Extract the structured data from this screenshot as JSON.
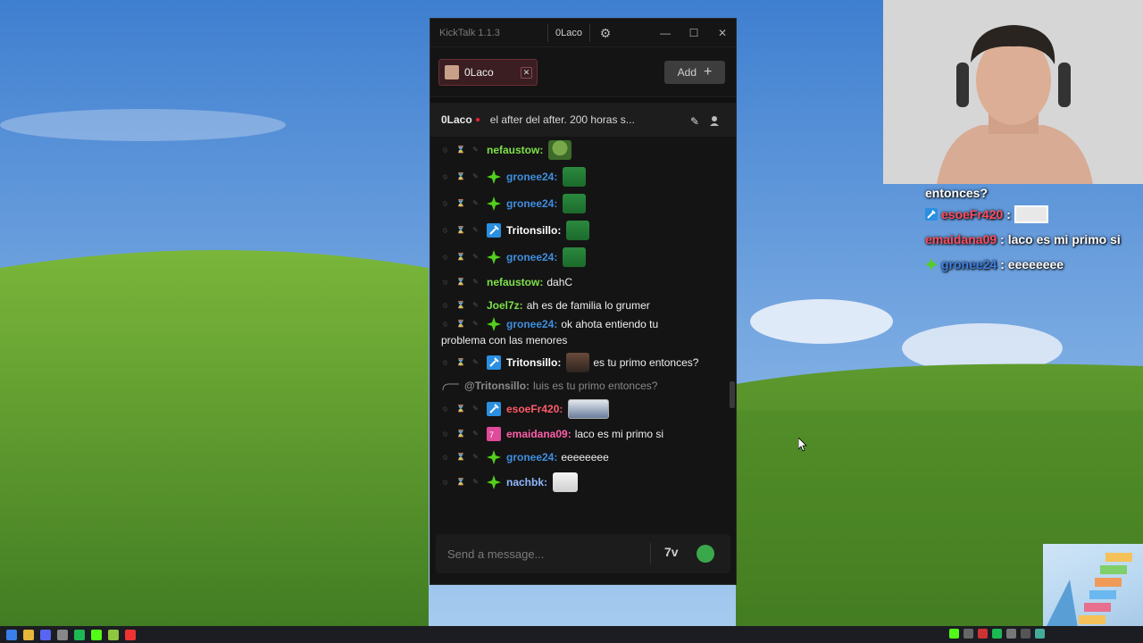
{
  "window": {
    "app_title": "KickTalk 1.1.3",
    "user_chip": "0Laco",
    "minimize_glyph": "—",
    "maximize_glyph": "☐",
    "close_glyph": "✕",
    "gear_glyph": "⚙"
  },
  "tabs": {
    "active_tab_label": "0Laco",
    "tab_close_glyph": "✕",
    "add_label": "Add",
    "add_glyph": "+"
  },
  "channel": {
    "name": "0Laco",
    "title": "el after del after. 200 horas s...",
    "pin_glyph": "✎",
    "user_glyph": "👤"
  },
  "chat": {
    "messages": [
      {
        "user": "nefaustow:",
        "color": "#7ee04a",
        "badge": "none",
        "text": "",
        "emote": "pepe"
      },
      {
        "user": "gronee24:",
        "color": "#3f8fe0",
        "badge": "green-star",
        "text": "",
        "emote": "green"
      },
      {
        "user": "gronee24:",
        "color": "#3f8fe0",
        "badge": "green-star",
        "text": "",
        "emote": "green"
      },
      {
        "user": "Tritonsillo:",
        "color": "#ffffff",
        "badge": "blue-hammer",
        "text": "",
        "emote": "green"
      },
      {
        "user": "gronee24:",
        "color": "#3f8fe0",
        "badge": "green-star",
        "text": "",
        "emote": "green"
      },
      {
        "user": "nefaustow:",
        "color": "#7ee04a",
        "badge": "none",
        "text": "dahC",
        "emote": ""
      },
      {
        "user": "Joel7z:",
        "color": "#7ee04a",
        "badge": "none",
        "text": "ah es de familia lo grumer",
        "emote": ""
      },
      {
        "user": "gronee24:",
        "color": "#3f8fe0",
        "badge": "green-star",
        "text": "ok ahota entiendo tu",
        "wrap": "problema con las menores",
        "emote": ""
      },
      {
        "user": "Tritonsillo:",
        "color": "#ffffff",
        "badge": "blue-hammer",
        "text": "es tu primo entonces?",
        "emote": "photo"
      },
      {
        "user": "esoeFr420:",
        "color": "#ff5a6a",
        "badge": "blue-hammer",
        "text": "",
        "emote": "photo2"
      },
      {
        "user": "emaidana09:",
        "color": "#ff5fa8",
        "badge": "pink-7tv",
        "text": "laco es mi primo si",
        "emote": ""
      },
      {
        "user": "gronee24:",
        "color": "#3f8fe0",
        "badge": "green-star",
        "text": "eeeeeeee",
        "emote": ""
      },
      {
        "user": "nachbk:",
        "color": "#8fb8ff",
        "badge": "green-star",
        "text": "",
        "emote": "meme"
      }
    ],
    "reply": {
      "user": "@Tritonsillo:",
      "text": "luis es tu primo entonces?"
    }
  },
  "input": {
    "placeholder": "Send a message...",
    "seventv_label": "7v"
  },
  "overlay": {
    "first_line": "entonces?",
    "lines": [
      {
        "user": "esoeFr420",
        "color": "#ff4d5e",
        "text": ":"
      },
      {
        "user": "emaidana09",
        "color": "#ff4d5e",
        "text": ": laco es mi primo si"
      },
      {
        "user": "gronee24",
        "color": "#3f7fe0",
        "text": ": eeeeeeee"
      }
    ]
  },
  "colors": {
    "accent_red": "#6a2e34",
    "kick_green": "#53fc18",
    "window_bg": "#141414"
  }
}
